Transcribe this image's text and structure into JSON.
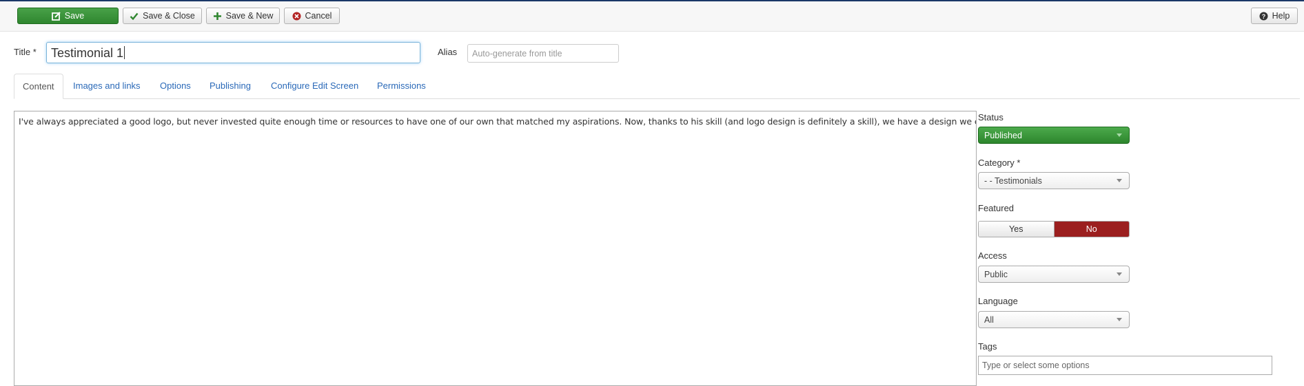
{
  "toolbar": {
    "save": "Save",
    "save_close": "Save & Close",
    "save_new": "Save & New",
    "cancel": "Cancel",
    "help": "Help"
  },
  "form": {
    "title_label": "Title *",
    "title_value": "Testimonial 1",
    "alias_label": "Alias",
    "alias_placeholder": "Auto-generate from title"
  },
  "tabs": [
    {
      "label": "Content",
      "active": true
    },
    {
      "label": "Images and links"
    },
    {
      "label": "Options"
    },
    {
      "label": "Publishing"
    },
    {
      "label": "Configure Edit Screen"
    },
    {
      "label": "Permissions"
    }
  ],
  "editor": {
    "text": "I've always appreciated a good logo, but never invested quite enough time or resources to have one of our own that matched my aspirations. Now, thanks to his skill (and logo design is definitely a skill), we have a design we can be proud of."
  },
  "sidebar": {
    "status_label": "Status",
    "status_value": "Published",
    "category_label": "Category *",
    "category_value": "- - Testimonials",
    "featured_label": "Featured",
    "featured_yes": "Yes",
    "featured_no": "No",
    "access_label": "Access",
    "access_value": "Public",
    "language_label": "Language",
    "language_value": "All",
    "tags_label": "Tags",
    "tags_placeholder": "Type or select some options"
  },
  "colors": {
    "success": "#3b953b",
    "danger": "#9b1f1f",
    "link": "#2a69b8",
    "focus_border": "#7bb4d9"
  }
}
